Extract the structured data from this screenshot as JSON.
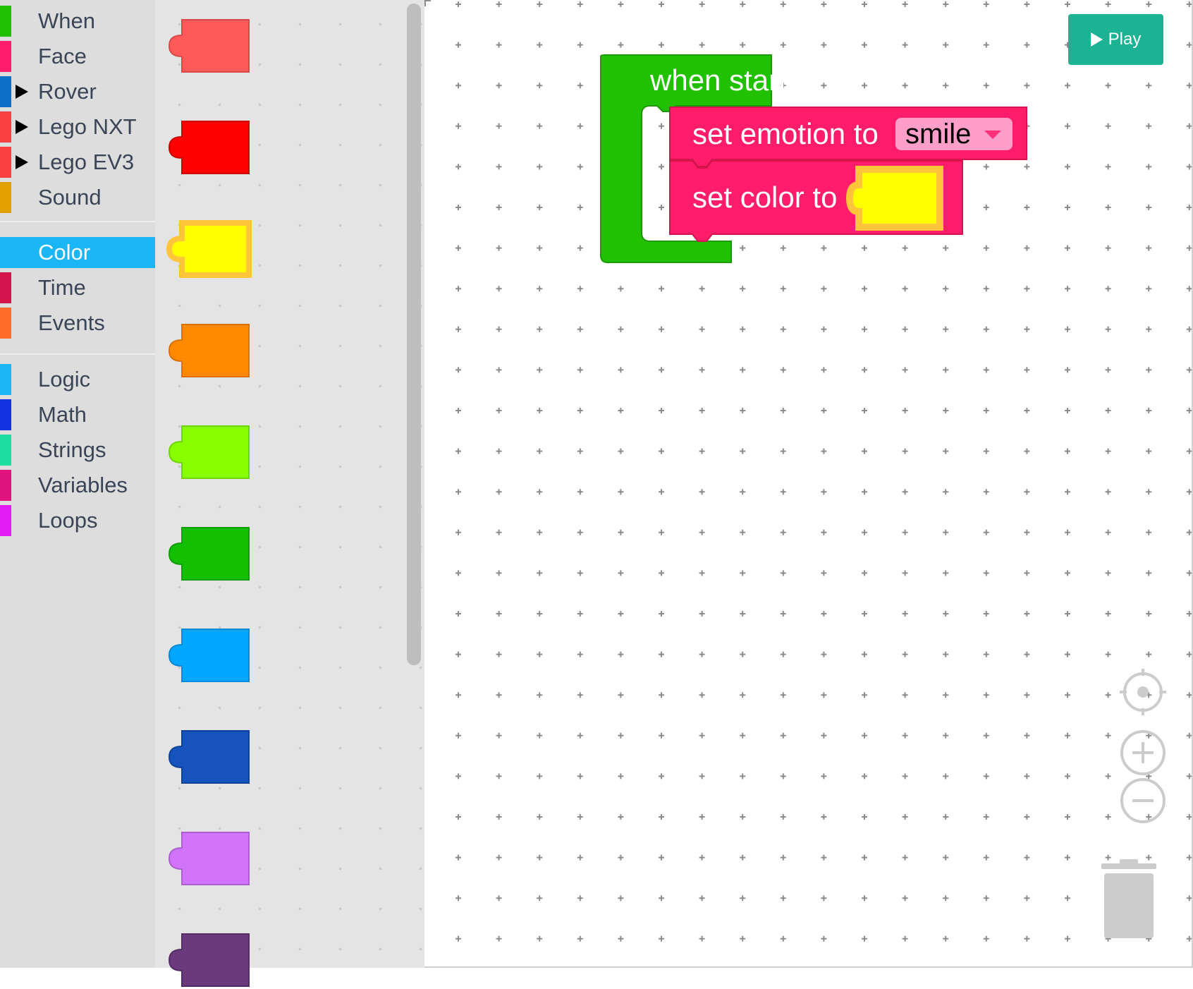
{
  "toolbox": {
    "groups": [
      [
        {
          "label": "When",
          "color": "#21c000",
          "arrow": false
        },
        {
          "label": "Face",
          "color": "#ff1c6b",
          "arrow": false
        },
        {
          "label": "Rover",
          "color": "#0f70c9",
          "arrow": true
        },
        {
          "label": "Lego NXT",
          "color": "#fa4040",
          "arrow": true
        },
        {
          "label": "Lego EV3",
          "color": "#fa4040",
          "arrow": true
        },
        {
          "label": "Sound",
          "color": "#e49f00",
          "arrow": false
        }
      ],
      [
        {
          "label": "Color",
          "color": "#1ab6f6",
          "arrow": false,
          "selected": true
        },
        {
          "label": "Time",
          "color": "#d4144d",
          "arrow": false
        },
        {
          "label": "Events",
          "color": "#ff6b2a",
          "arrow": false
        }
      ],
      [
        {
          "label": "Logic",
          "color": "#1ab6f6",
          "arrow": false
        },
        {
          "label": "Math",
          "color": "#1332e0",
          "arrow": false
        },
        {
          "label": "Strings",
          "color": "#1fdfa0",
          "arrow": false
        },
        {
          "label": "Variables",
          "color": "#e0147e",
          "arrow": false
        },
        {
          "label": "Loops",
          "color": "#e31af4",
          "arrow": false
        }
      ]
    ]
  },
  "flyout": {
    "swatches": [
      {
        "name": "color-block-salmon",
        "fill": "#ff5a5a",
        "edge": "#d84a4a"
      },
      {
        "name": "color-block-red",
        "fill": "#ff0000",
        "edge": "#cc0000"
      },
      {
        "name": "color-block-yellow",
        "fill": "#ffff00",
        "edge": "#ffc53a",
        "selected": true
      },
      {
        "name": "color-block-orange",
        "fill": "#ff8a00",
        "edge": "#d87200"
      },
      {
        "name": "color-block-lime",
        "fill": "#88ff00",
        "edge": "#70d400"
      },
      {
        "name": "color-block-green",
        "fill": "#13bf00",
        "edge": "#0f9d00"
      },
      {
        "name": "color-block-sky-blue",
        "fill": "#00a6ff",
        "edge": "#0089d4"
      },
      {
        "name": "color-block-dark-blue",
        "fill": "#1653bd",
        "edge": "#10429a"
      },
      {
        "name": "color-block-violet",
        "fill": "#d274fa",
        "edge": "#ad5ed0"
      },
      {
        "name": "color-block-purple",
        "fill": "#6a3a7d",
        "edge": "#552e65"
      }
    ]
  },
  "workspace": {
    "play_label": "Play",
    "event_block": {
      "label": "when start",
      "color": "#21c000"
    },
    "emotion_block": {
      "label": "set emotion to",
      "dropdown_value": "smile",
      "color": "#ff1c6b"
    },
    "color_block": {
      "label": "set color to",
      "color_value": "#ffff00",
      "color": "#ff1c6b"
    }
  },
  "controls": {
    "recenter": "crosshair-icon",
    "zoom_in": "zoom-in-icon",
    "zoom_out": "zoom-out-icon",
    "trash": "trash-icon"
  }
}
